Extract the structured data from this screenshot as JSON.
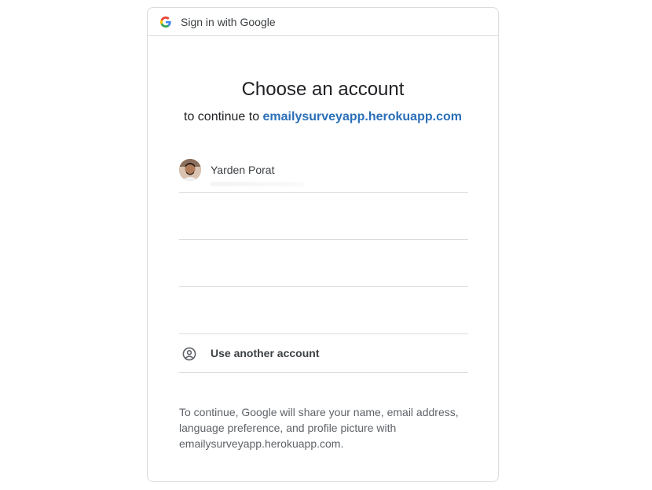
{
  "header": {
    "logo_icon": "google-g-icon",
    "title": "Sign in with Google"
  },
  "main": {
    "title": "Choose an account",
    "subtitle_prefix": "to continue to ",
    "subtitle_link": "emailysurveyapp.herokuapp.com"
  },
  "accounts": [
    {
      "name": "Yarden Porat",
      "avatar_icon": "user-avatar"
    }
  ],
  "use_another": {
    "icon": "account-circle-icon",
    "label": "Use another account"
  },
  "footer": {
    "text": "To continue, Google will share your name, email address, language preference, and profile picture with emailysurveyapp.herokuapp.com."
  },
  "colors": {
    "link": "#2a6fb8",
    "border": "#dadce0",
    "text": "#3c4043"
  }
}
